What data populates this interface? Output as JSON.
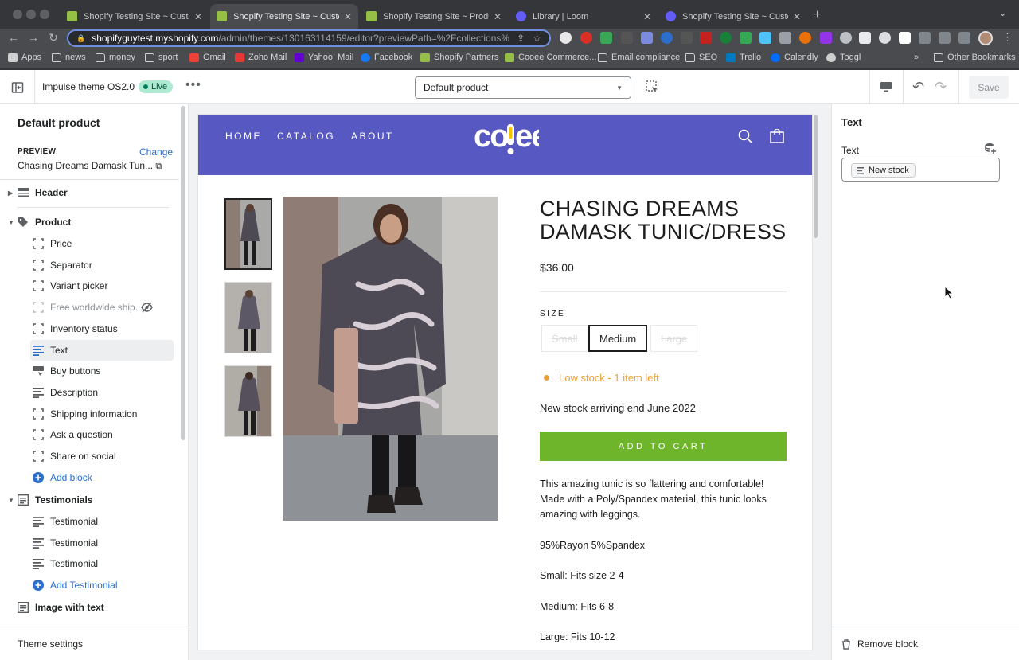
{
  "browser": {
    "tabs": [
      {
        "title": "Shopify Testing Site ~ Customi",
        "active": false,
        "favicon": "shopify-icon"
      },
      {
        "title": "Shopify Testing Site ~ Customi",
        "active": true,
        "favicon": "shopify-icon"
      },
      {
        "title": "Shopify Testing Site ~ Product",
        "active": false,
        "favicon": "shopify-icon"
      },
      {
        "title": "Library | Loom",
        "active": false,
        "favicon": "loom-icon"
      },
      {
        "title": "Shopify Testing Site ~ Customi",
        "active": false,
        "favicon": "loom-icon"
      }
    ],
    "url_host": "shopifyguytest.myshopify.com",
    "url_path": "/admin/themes/130163114159/editor?previewPath=%2Fcollections%...",
    "bookmarks": [
      {
        "label": "Apps",
        "icon": "apps-grid-icon"
      },
      {
        "label": "news",
        "icon": "folder-icon"
      },
      {
        "label": "money",
        "icon": "folder-icon"
      },
      {
        "label": "sport",
        "icon": "folder-icon"
      },
      {
        "label": "Gmail",
        "icon": "gmail-icon"
      },
      {
        "label": "Zoho Mail",
        "icon": "zoho-icon"
      },
      {
        "label": "Yahoo! Mail",
        "icon": "yahoo-icon"
      },
      {
        "label": "Facebook",
        "icon": "facebook-icon"
      },
      {
        "label": "Shopify Partners",
        "icon": "shopify-icon"
      },
      {
        "label": "Cooee Commerce...",
        "icon": "shopify-icon"
      },
      {
        "label": "Email compliance",
        "icon": "folder-icon"
      },
      {
        "label": "SEO",
        "icon": "folder-icon"
      },
      {
        "label": "Trello",
        "icon": "trello-icon"
      },
      {
        "label": "Calendly",
        "icon": "calendly-icon"
      },
      {
        "label": "Toggl",
        "icon": "toggl-icon"
      }
    ],
    "more_bookmarks": "»",
    "other_bookmarks": "Other Bookmarks"
  },
  "editor": {
    "theme_name": "Impulse theme OS2.0",
    "live_badge": "Live",
    "template_select": "Default product",
    "save_label": "Save"
  },
  "left_panel": {
    "title": "Default product",
    "preview_label": "PREVIEW",
    "change_label": "Change",
    "preview_value": "Chasing Dreams Damask Tun...",
    "sections": [
      {
        "label": "Header",
        "expanded": false
      },
      {
        "label": "Product",
        "expanded": true
      },
      {
        "label": "Testimonials",
        "expanded": true
      },
      {
        "label": "Image with text",
        "expanded": false
      }
    ],
    "product_blocks": [
      {
        "label": "Price",
        "icon": "block-outline-icon"
      },
      {
        "label": "Separator",
        "icon": "block-outline-icon"
      },
      {
        "label": "Variant picker",
        "icon": "block-outline-icon"
      },
      {
        "label": "Free worldwide ship...",
        "icon": "block-outline-icon",
        "hidden": true
      },
      {
        "label": "Inventory status",
        "icon": "block-outline-icon"
      },
      {
        "label": "Text",
        "icon": "text-lines-icon",
        "selected": true
      },
      {
        "label": "Buy buttons",
        "icon": "buy-buttons-icon"
      },
      {
        "label": "Description",
        "icon": "text-lines-icon"
      },
      {
        "label": "Shipping information",
        "icon": "block-outline-icon"
      },
      {
        "label": "Ask a question",
        "icon": "block-outline-icon"
      },
      {
        "label": "Share on social",
        "icon": "block-outline-icon"
      }
    ],
    "add_block": "Add block",
    "testimonials": [
      "Testimonial",
      "Testimonial",
      "Testimonial"
    ],
    "add_testimonial": "Add Testimonial",
    "theme_settings": "Theme settings"
  },
  "store": {
    "nav": [
      "HOME",
      "CATALOG",
      "ABOUT"
    ],
    "logo_text": "cooee",
    "product_title": "CHASING DREAMS DAMASK TUNIC/DRESS",
    "price": "$36.00",
    "size_label": "SIZE",
    "sizes": [
      {
        "label": "Small",
        "state": "unavailable"
      },
      {
        "label": "Medium",
        "state": "selected"
      },
      {
        "label": "Large",
        "state": "unavailable"
      }
    ],
    "stock_status": "Low stock - 1 item left",
    "new_stock_text": "New stock arriving end June 2022",
    "add_to_cart": "ADD TO CART",
    "description": [
      "This amazing tunic is so flattering and comfortable! Made with a Poly/Spandex material, this tunic looks amazing with leggings.",
      "95%Rayon 5%Spandex",
      "Small: Fits size 2-4",
      "Medium: Fits 6-8",
      "Large: Fits 10-12"
    ],
    "colors": {
      "nav_bg": "#5858c2",
      "cart_button": "#6fb52c",
      "low_stock": "#e9a23b"
    }
  },
  "right_panel": {
    "title": "Text",
    "field_label": "Text",
    "field_value": "New stock",
    "remove_block": "Remove block"
  }
}
